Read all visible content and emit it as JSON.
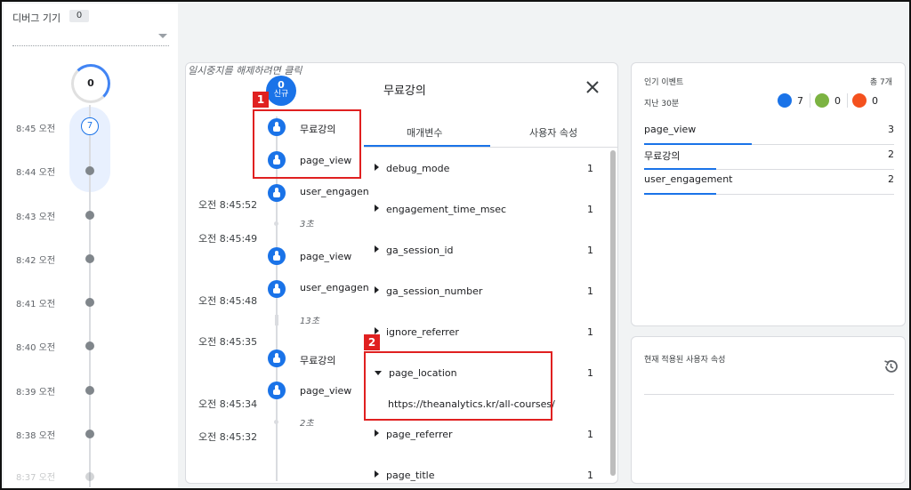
{
  "device": {
    "label": "디버그 기기",
    "count": "0"
  },
  "timeline": {
    "cap_count": "0",
    "active_count": "7",
    "times": [
      "8:45 오전",
      "8:44 오전",
      "8:43 오전",
      "8:42 오전",
      "8:41 오전",
      "8:40 오전",
      "8:39 오전",
      "8:38 오전",
      "8:37 오전"
    ]
  },
  "stream": {
    "pause_hint": "일시중지를 해제하려면 클릭",
    "new_count": "0",
    "new_label": "신규",
    "events": [
      {
        "name": "무료강의",
        "time": ""
      },
      {
        "name": "page_view",
        "time": ""
      },
      {
        "name": "user_engagen",
        "time": "오전 8:45:52"
      },
      {
        "name": "page_view",
        "time": "오전 8:45:49"
      },
      {
        "name": "user_engagen",
        "time": "오전 8:45:48"
      },
      {
        "name": "무료강의",
        "time": "오전 8:45:35"
      },
      {
        "name": "page_view",
        "time": "오전 8:45:34"
      }
    ],
    "gaps": [
      "3초",
      "13초",
      "2초"
    ],
    "last_time": "오전 8:45:32"
  },
  "detail": {
    "title": "무료강의",
    "tabs": [
      "매개변수",
      "사용자 속성"
    ],
    "params": [
      {
        "name": "debug_mode",
        "value": "1"
      },
      {
        "name": "engagement_time_msec",
        "value": "1"
      },
      {
        "name": "ga_session_id",
        "value": "1"
      },
      {
        "name": "ga_session_number",
        "value": "1"
      },
      {
        "name": "ignore_referrer",
        "value": "1"
      },
      {
        "name": "page_location",
        "value": "1"
      },
      {
        "name": "page_referrer",
        "value": "1"
      },
      {
        "name": "page_title",
        "value": "1"
      }
    ],
    "page_location_url": "https://theanalytics.kr/all-courses/"
  },
  "highlights": [
    "1",
    "2"
  ],
  "top_events": {
    "title": "인기 이벤트",
    "total": "총 7개",
    "period": "지난 30분",
    "counts": [
      {
        "icon": "event-icon",
        "value": "7",
        "color": "#1a73e8"
      },
      {
        "icon": "conversion-flag-icon",
        "value": "0",
        "color": "#7cb342"
      },
      {
        "icon": "error-gift-icon",
        "value": "0",
        "color": "#f4511e"
      }
    ],
    "rows": [
      {
        "name": "page_view",
        "count": "3",
        "share": 0.43
      },
      {
        "name": "무료강의",
        "count": "2",
        "share": 0.29
      },
      {
        "name": "user_engagement",
        "count": "2",
        "share": 0.29
      }
    ]
  },
  "user_props": {
    "title": "현재 적용된 사용자 속성"
  }
}
